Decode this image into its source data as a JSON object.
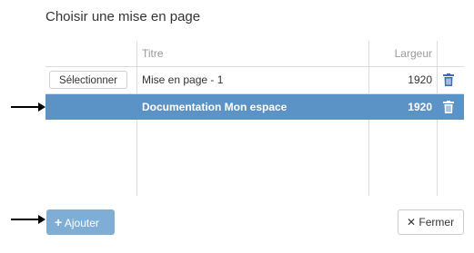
{
  "dialog": {
    "title": "Choisir une mise en page"
  },
  "table": {
    "headers": {
      "title": "Titre",
      "width": "Largeur"
    },
    "rows": [
      {
        "select_label": "Sélectionner",
        "title": "Mise en page - 1",
        "width": "1920",
        "selected": false
      },
      {
        "select_label": "",
        "title": "Documentation Mon espace",
        "width": "1920",
        "selected": true
      }
    ]
  },
  "footer": {
    "add_label": "Ajouter",
    "close_label": "Fermer"
  },
  "colors": {
    "accent": "#5b93c7",
    "add_button": "#7eaed6",
    "delete_icon": "#3a6fb0"
  }
}
